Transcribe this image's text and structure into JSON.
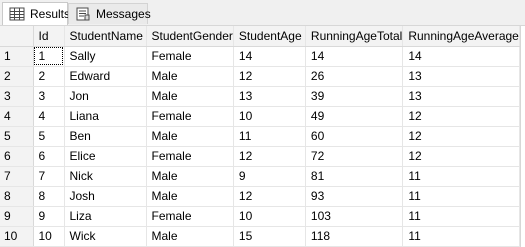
{
  "tabs": [
    {
      "label": "Results",
      "icon": "results-grid-icon"
    },
    {
      "label": "Messages",
      "icon": "messages-icon"
    }
  ],
  "table": {
    "columns": [
      "Id",
      "StudentName",
      "StudentGender",
      "StudentAge",
      "RunningAgeTotal",
      "RunningAgeAverage"
    ],
    "rows": [
      [
        "1",
        "Sally",
        "Female",
        "14",
        "14",
        "14"
      ],
      [
        "2",
        "Edward",
        "Male",
        "12",
        "26",
        "13"
      ],
      [
        "3",
        "Jon",
        "Male",
        "13",
        "39",
        "13"
      ],
      [
        "4",
        "Liana",
        "Female",
        "10",
        "49",
        "12"
      ],
      [
        "5",
        "Ben",
        "Male",
        "11",
        "60",
        "12"
      ],
      [
        "6",
        "Elice",
        "Female",
        "12",
        "72",
        "12"
      ],
      [
        "7",
        "Nick",
        "Male",
        "9",
        "81",
        "11"
      ],
      [
        "8",
        "Josh",
        "Male",
        "12",
        "93",
        "11"
      ],
      [
        "9",
        "Liza",
        "Female",
        "10",
        "103",
        "11"
      ],
      [
        "10",
        "Wick",
        "Male",
        "15",
        "118",
        "11"
      ]
    ],
    "row_numbers": [
      "1",
      "2",
      "3",
      "4",
      "5",
      "6",
      "7",
      "8",
      "9",
      "10"
    ]
  }
}
